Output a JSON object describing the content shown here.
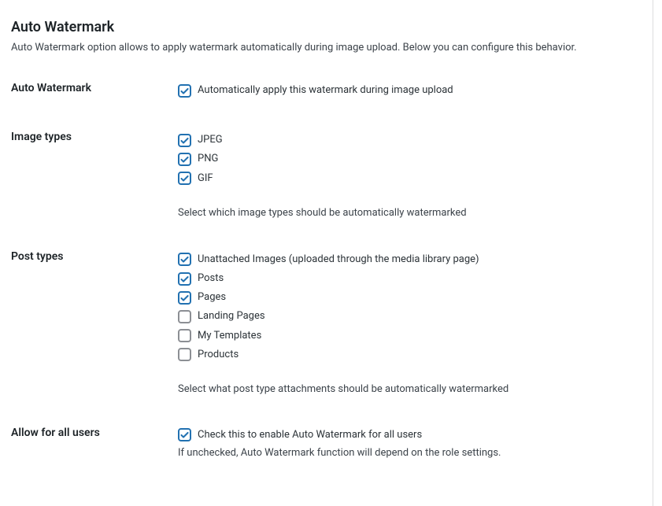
{
  "section": {
    "title": "Auto Watermark",
    "description": "Auto Watermark option allows to apply watermark automatically during image upload. Below you can configure this behavior."
  },
  "fields": {
    "auto_watermark": {
      "label": "Auto Watermark",
      "option_label": "Automatically apply this watermark during image upload",
      "checked": true
    },
    "image_types": {
      "label": "Image types",
      "options": [
        {
          "label": "JPEG",
          "checked": true
        },
        {
          "label": "PNG",
          "checked": true
        },
        {
          "label": "GIF",
          "checked": true
        }
      ],
      "hint": "Select which image types should be automatically watermarked"
    },
    "post_types": {
      "label": "Post types",
      "options": [
        {
          "label": "Unattached Images (uploaded through the media library page)",
          "checked": true
        },
        {
          "label": "Posts",
          "checked": true
        },
        {
          "label": "Pages",
          "checked": true
        },
        {
          "label": "Landing Pages",
          "checked": false
        },
        {
          "label": "My Templates",
          "checked": false
        },
        {
          "label": "Products",
          "checked": false
        }
      ],
      "hint": "Select what post type attachments should be automatically watermarked"
    },
    "allow_all": {
      "label": "Allow for all users",
      "option_label": "Check this to enable Auto Watermark for all users",
      "checked": true,
      "hint": "If unchecked, Auto Watermark function will depend on the role settings."
    }
  }
}
